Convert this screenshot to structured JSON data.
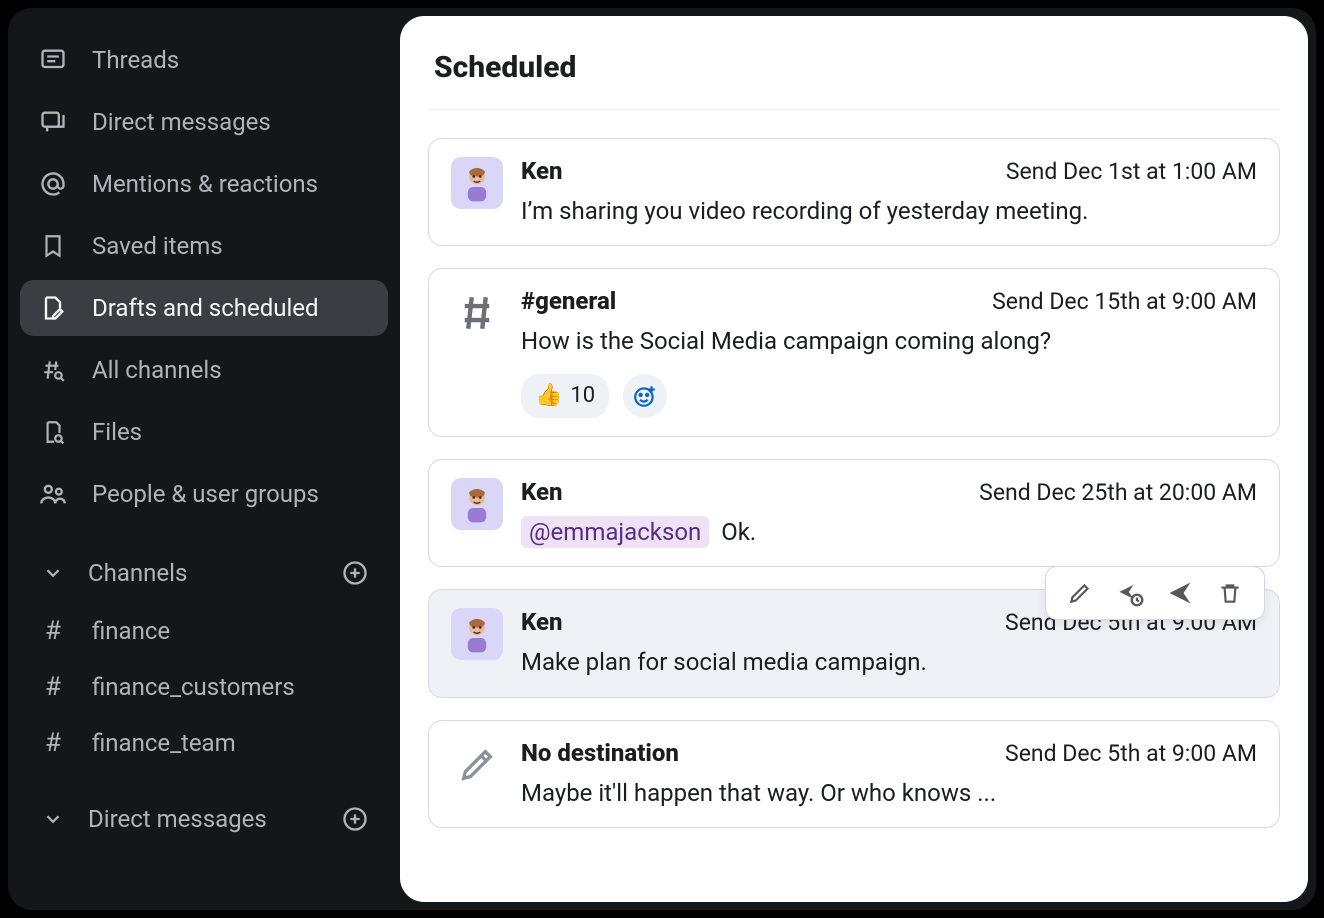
{
  "sidebar": {
    "nav": [
      {
        "id": "threads",
        "label": "Threads"
      },
      {
        "id": "dms",
        "label": "Direct messages"
      },
      {
        "id": "mentions",
        "label": "Mentions & reactions"
      },
      {
        "id": "saved",
        "label": "Saved items"
      },
      {
        "id": "drafts",
        "label": "Drafts and scheduled"
      },
      {
        "id": "allchannels",
        "label": "All channels"
      },
      {
        "id": "files",
        "label": "Files"
      },
      {
        "id": "people",
        "label": "People & user groups"
      }
    ],
    "channels_header": "Channels",
    "channels": [
      {
        "name": "finance"
      },
      {
        "name": "finance_customers"
      },
      {
        "name": "finance_team"
      }
    ],
    "dm_header": "Direct messages"
  },
  "main": {
    "title": "Scheduled",
    "messages": [
      {
        "avatar": "user",
        "recipient": "Ken",
        "send_time": "Send Dec 1st at 1:00 AM",
        "text": "I’m sharing you video recording of yesterday meeting."
      },
      {
        "avatar": "channel",
        "recipient": "#general",
        "send_time": "Send Dec 15th at 9:00 AM",
        "text": "How is the Social Media campaign coming along?",
        "reaction_emoji": "👍",
        "reaction_count": "10"
      },
      {
        "avatar": "user",
        "recipient": "Ken",
        "send_time": "Send Dec 25th at 20:00 AM",
        "mention": "@emmajackson",
        "text_after": "Ok."
      },
      {
        "avatar": "user",
        "recipient": "Ken",
        "send_time": "Send Dec 5th at 9:00 AM",
        "text": "Make plan for social media campaign.",
        "hovered": true
      },
      {
        "avatar": "pencil",
        "recipient": "No destination",
        "send_time": "Send Dec 5th at 9:00 AM",
        "text": "Maybe it'll happen that way. Or who knows ..."
      }
    ]
  }
}
